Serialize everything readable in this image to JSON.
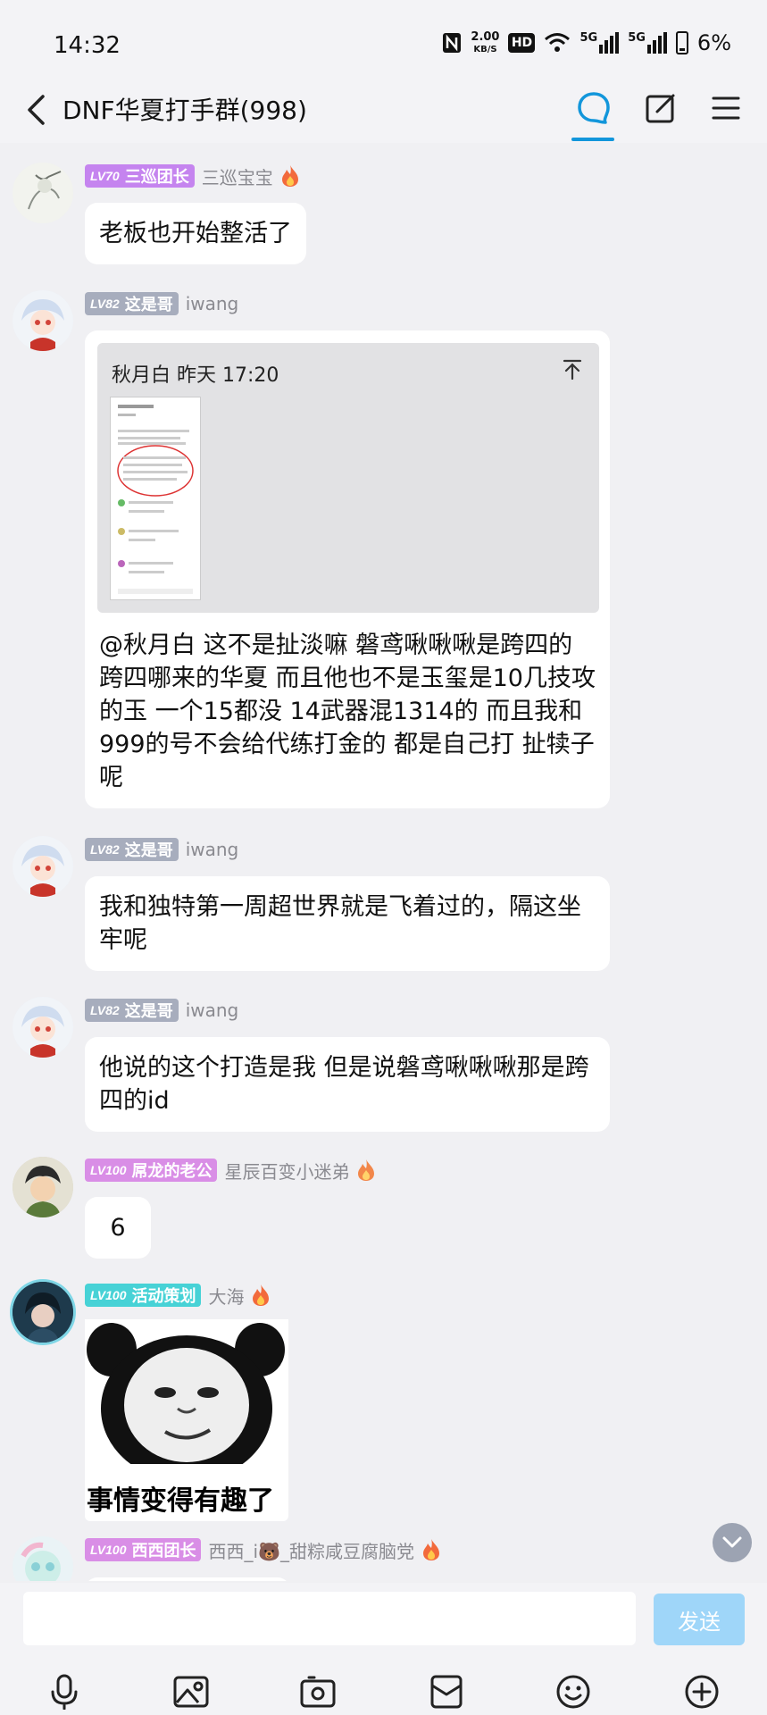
{
  "status_bar": {
    "time": "14:32",
    "net_speed_value": "2.00",
    "net_speed_unit": "KB/S",
    "hd_label": "HD",
    "signal_label_1": "5G",
    "signal_label_2": "5G",
    "battery": "6%"
  },
  "header": {
    "title": "DNF华夏打手群(998)",
    "icons": [
      "chevron-left-icon",
      "chat-bubble-icon",
      "edit-icon",
      "menu-icon"
    ],
    "active_tab_color": "#1296db"
  },
  "colors": {
    "badge_purple": "#c584ef",
    "badge_gray": "#a7adbd",
    "badge_pink": "#d98ee6",
    "badge_cyan": "#47d2d6",
    "send_button": "#9fd6f9"
  },
  "messages": [
    {
      "level": "LV70",
      "title": "三巡团长",
      "nick": "三巡宝宝",
      "text": "老板也开始整活了"
    },
    {
      "level": "LV82",
      "title": "这是哥",
      "nick": "iwang",
      "quote_header": "秋月白 昨天 17:20",
      "text": "@秋月白 这不是扯淡嘛 磐鸢啾啾啾是跨四的跨四哪来的华夏 而且他也不是玉玺是10几技攻的玉 一个15都没 14武器混1314的 而且我和999的号不会给代练打金的 都是自己打 扯犊子呢"
    },
    {
      "level": "LV82",
      "title": "这是哥",
      "nick": "iwang",
      "text": "我和独特第一周超世界就是飞着过的，隔这坐牢呢"
    },
    {
      "level": "LV82",
      "title": "这是哥",
      "nick": "iwang",
      "text": "他说的这个打造是我 但是说磐鸢啾啾啾那是跨四的id"
    },
    {
      "level": "LV100",
      "title": "屌龙的老公",
      "nick": "星辰百变小迷弟",
      "text": "6"
    },
    {
      "level": "LV100",
      "title": "活动策划",
      "nick": "大海",
      "sticker_caption": "事情变得有趣了"
    },
    {
      "level": "LV100",
      "title": "西西团长",
      "nick": "西西_i🐻_甜粽咸豆腐脑党"
    }
  ],
  "input": {
    "placeholder": "",
    "send_label": "发送"
  },
  "toolbar": [
    "microphone-icon",
    "image-icon",
    "camera-icon",
    "package-icon",
    "emoji-icon",
    "plus-circle-icon"
  ]
}
